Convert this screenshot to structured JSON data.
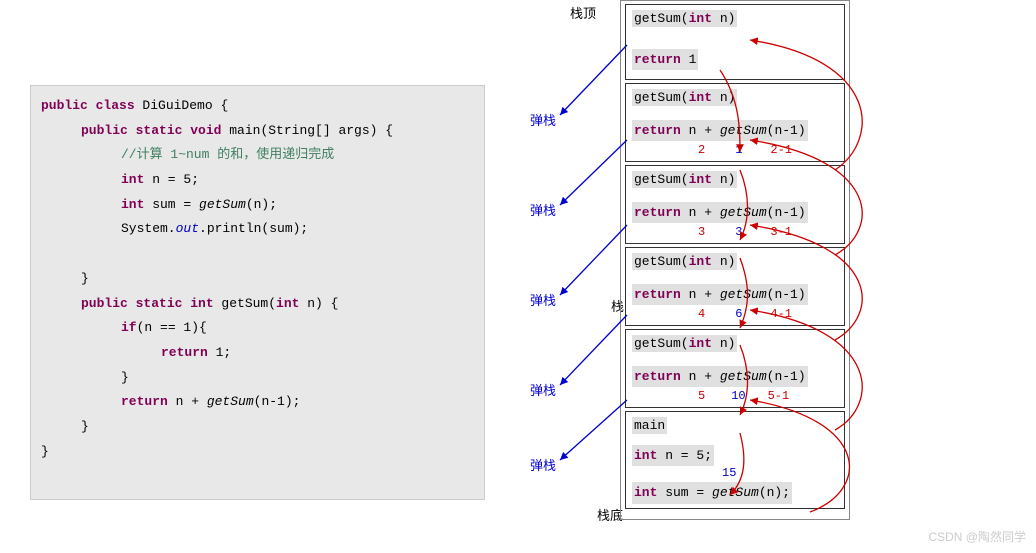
{
  "code": {
    "l1_kw1": "public class",
    "l1_cls": " DiGuiDemo {",
    "l2_kw1": "public static void",
    "l2_fn": " main(String[] args) {",
    "l3_cmt": "//计算 1~num 的和，使用递归完成",
    "l4_kw": "int",
    "l4_rest": " n = 5;",
    "l5_kw": "int",
    "l5_mid": " sum = ",
    "l5_fn": "getSum",
    "l5_end": "(n);",
    "l6_a": "System.",
    "l6_b": "out",
    "l6_c": ".println(sum);",
    "l7": "}",
    "l8_kw": "public static int",
    "l8_fn": " getSum(",
    "l8_kw2": "int",
    "l8_end": " n) {",
    "l9_kw": "if",
    "l9_rest": "(n == 1){",
    "l10_kw": "return",
    "l10_rest": " 1;",
    "l11": "}",
    "l12_kw": "return",
    "l12_mid": " n + ",
    "l12_fn": "getSum",
    "l12_end": "(n-1);",
    "l13": "}",
    "l14": "}"
  },
  "labels": {
    "top": "栈顶",
    "mid": "栈",
    "bottom": "栈底",
    "pop": "弹栈"
  },
  "frames": [
    {
      "sig_fn": "getSum(",
      "sig_kw": "int",
      "sig_end": " n)",
      "body_kw": "return",
      "body_rest": " 1",
      "annot_n": "",
      "annot_mid": "",
      "annot_arg": ""
    },
    {
      "sig_fn": "getSum(",
      "sig_kw": "int",
      "sig_end": " n)",
      "body_kw": "return",
      "body_mid": " n + ",
      "body_fn": "getSum",
      "body_end": "(n-1)",
      "annot_n": "2",
      "annot_mid": "1",
      "annot_arg": "2-1"
    },
    {
      "sig_fn": "getSum(",
      "sig_kw": "int",
      "sig_end": " n)",
      "body_kw": "return",
      "body_mid": " n + ",
      "body_fn": "getSum",
      "body_end": "(n-1)",
      "annot_n": "3",
      "annot_mid": "3",
      "annot_arg": "3-1"
    },
    {
      "sig_fn": "getSum(",
      "sig_kw": "int",
      "sig_end": " n)",
      "body_kw": "return",
      "body_mid": " n + ",
      "body_fn": "getSum",
      "body_end": "(n-1)",
      "annot_n": "4",
      "annot_mid": "6",
      "annot_arg": "4-1"
    },
    {
      "sig_fn": "getSum(",
      "sig_kw": "int",
      "sig_end": " n)",
      "body_kw": "return",
      "body_mid": " n + ",
      "body_fn": "getSum",
      "body_end": "(n-1)",
      "annot_n": "5",
      "annot_mid": "10",
      "annot_arg": "5-1"
    }
  ],
  "main_frame": {
    "title": "main",
    "l1_kw": "int",
    "l1_rest": " n = 5;",
    "l2_kw": "int",
    "l2_mid": " sum = ",
    "l2_fn": "getSum",
    "l2_end": "(n);",
    "result": "15"
  },
  "watermark": "CSDN @陶然同学"
}
